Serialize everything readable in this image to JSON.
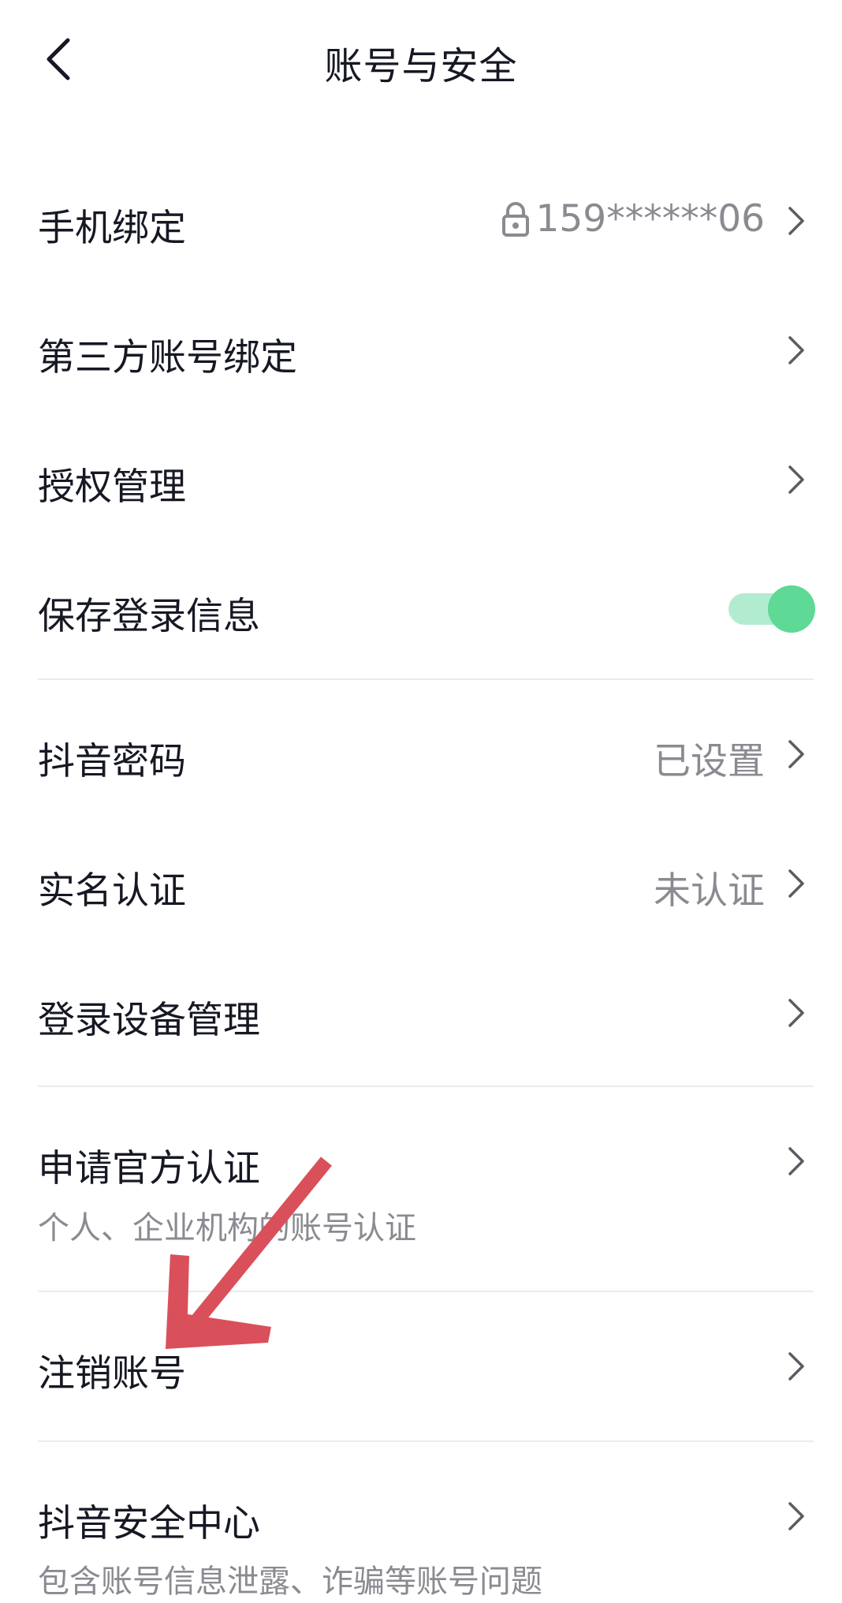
{
  "header": {
    "title": "账号与安全"
  },
  "rows": [
    {
      "label": "手机绑定",
      "value": "159******06"
    },
    {
      "label": "第三方账号绑定"
    },
    {
      "label": "授权管理"
    },
    {
      "label": "保存登录信息",
      "toggle_on": true
    },
    {
      "label": "抖音密码",
      "value": "已设置"
    },
    {
      "label": "实名认证",
      "value": "未认证"
    },
    {
      "label": "登录设备管理"
    },
    {
      "label": "申请官方认证",
      "sub": "个人、企业机构的账号认证"
    },
    {
      "label": "注销账号"
    },
    {
      "label": "抖音安全中心",
      "sub": "包含账号信息泄露、诈骗等账号问题"
    }
  ],
  "colors": {
    "toggle_track": "#b2ecd0",
    "toggle_knob": "#5ed996",
    "annotation_arrow": "#d9505a"
  }
}
